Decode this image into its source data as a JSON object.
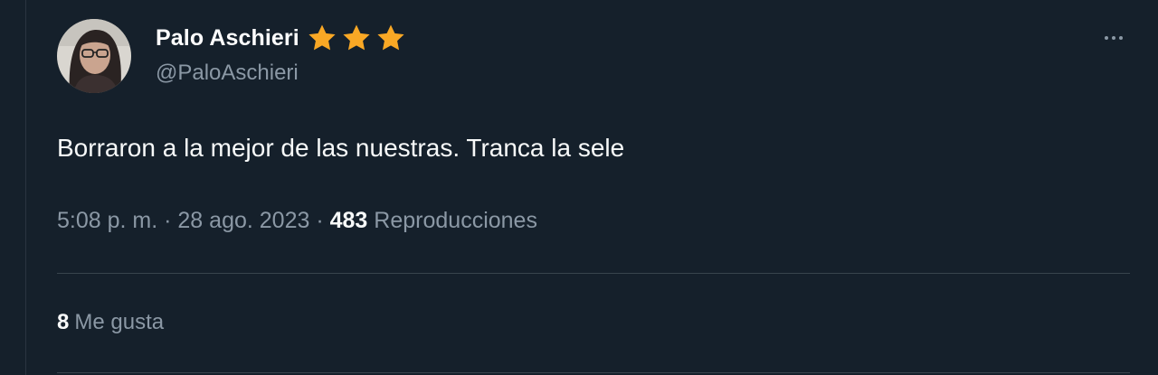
{
  "author": {
    "display_name": "Palo Aschieri",
    "handle": "@PaloAschieri",
    "badge_icons": [
      "star-icon",
      "star-icon",
      "star-icon"
    ],
    "badge_color": "#f9a825"
  },
  "tweet": {
    "text": "Borraron a la mejor de las nuestras. Tranca la sele",
    "time": "5:08 p. m.",
    "separator": "·",
    "date": "28 ago. 2023",
    "views_count": "483",
    "views_label": "Reproducciones"
  },
  "stats": {
    "likes_count": "8",
    "likes_label": "Me gusta"
  },
  "icons": {
    "more": "more-horizontal-icon"
  },
  "colors": {
    "background": "#15202b",
    "primary_text": "#f7f9f9",
    "secondary_text": "#8b98a5",
    "divider": "#38444d"
  }
}
